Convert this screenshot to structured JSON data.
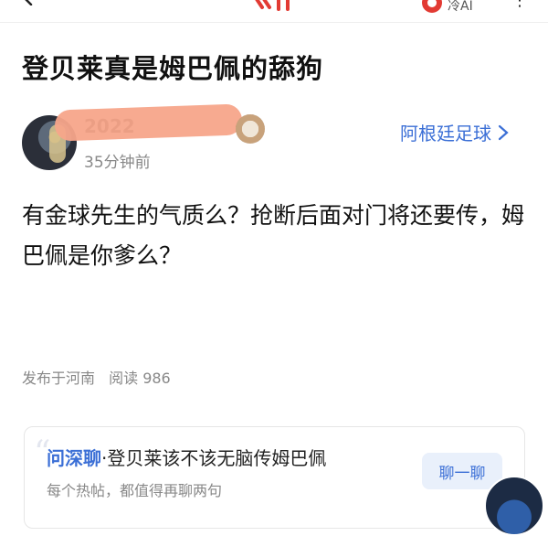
{
  "topbar": {
    "app_label": "冷AI"
  },
  "post": {
    "title": "登贝莱真是姆巴佩的舔狗",
    "author_name": "2022",
    "time": "35分钟前",
    "channel": "阿根廷足球",
    "body": "有金球先生的气质么？抢断后面对门将还要传，姆巴佩是你爹么？",
    "location": "发布于河南",
    "reads_label": "阅读 986"
  },
  "ask_card": {
    "prefix": "问深聊",
    "separator": "·",
    "question": "登贝莱该不该无脑传姆巴佩",
    "subtitle": "每个热帖，都值得再聊两句",
    "button_label": "聊一聊"
  },
  "colors": {
    "accent": "#3b6fd6",
    "redaction": "#f7a58a",
    "brand": "#e23a33"
  }
}
